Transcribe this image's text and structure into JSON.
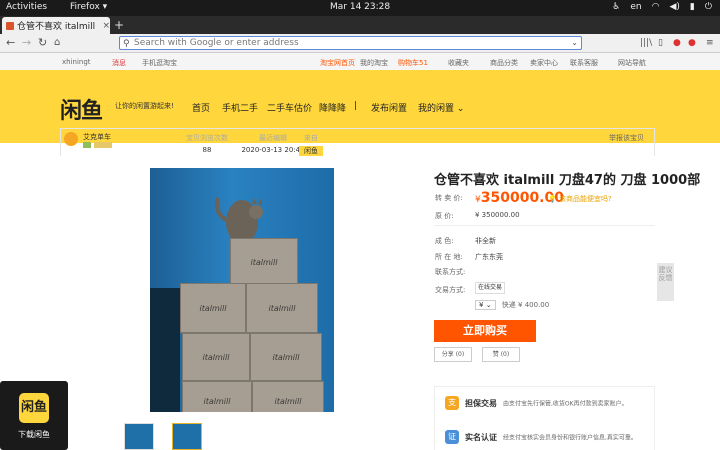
{
  "system": {
    "activities": "Activities",
    "app": "Firefox",
    "clock": "Mar 14 23:28",
    "lang": "en"
  },
  "browser": {
    "tab_title": "仓管不喜欢 italmill",
    "url_placeholder": "Search with Google or enter address"
  },
  "top_links": {
    "user": "xhiningt",
    "msg": "消息",
    "mobile": "手机逛淘宝",
    "home": "淘宝网首页",
    "mytaobao": "我的淘宝",
    "cart": "购物车51",
    "fav": "收藏夹",
    "category": "商品分类",
    "seller": "卖家中心",
    "service": "联系客服",
    "sitenav": "网站导航"
  },
  "header": {
    "logo": "闲鱼",
    "slogan": "让你的闲置游起来!",
    "menu": [
      "首页",
      "手机二手",
      "二手车估价",
      "降降降",
      "|",
      "发布闲置",
      "我的闲置"
    ]
  },
  "seller": {
    "name": "艾克单车",
    "views_label": "宝贝浏览次数",
    "views": "88",
    "edit_label": "最近编辑",
    "edit_time": "2020-03-13 20:49",
    "from_label": "来自",
    "from_value": "闲鱼",
    "report": "举报该宝贝"
  },
  "item": {
    "title": "仓管不喜欢 italmill 刀盘47的 刀盘 1000部",
    "price_label": "转 卖 价:",
    "currency": "¥",
    "price": "350000.00",
    "lower_hint": "该商品能便宜吗?",
    "orig_label": "原      价:",
    "orig_price": "¥ 350000.00",
    "cond_label": "成      色:",
    "cond": "非全新",
    "loc_label": "所 在 地:",
    "loc": "广东东莞",
    "contact_label": "联系方式:",
    "trade_label": "交易方式:",
    "trade": "在线交易",
    "qty": "¥",
    "ship_label": "快递",
    "ship": "¥ 400.00",
    "buy": "立即购买",
    "share": "分享 (0)",
    "like": "赞 (0)",
    "box_text": "italmill"
  },
  "assure": [
    {
      "icon": "支",
      "name": "担保交易",
      "desc": "由支付宝先行保管,收货OK再付款到卖家账户。"
    },
    {
      "icon": "证",
      "name": "实名认证",
      "desc": "经支付宝核实会员身份和银行账户信息,真实可靠。"
    }
  ],
  "side_tool": "建议反馈",
  "download": "下载闲鱼"
}
